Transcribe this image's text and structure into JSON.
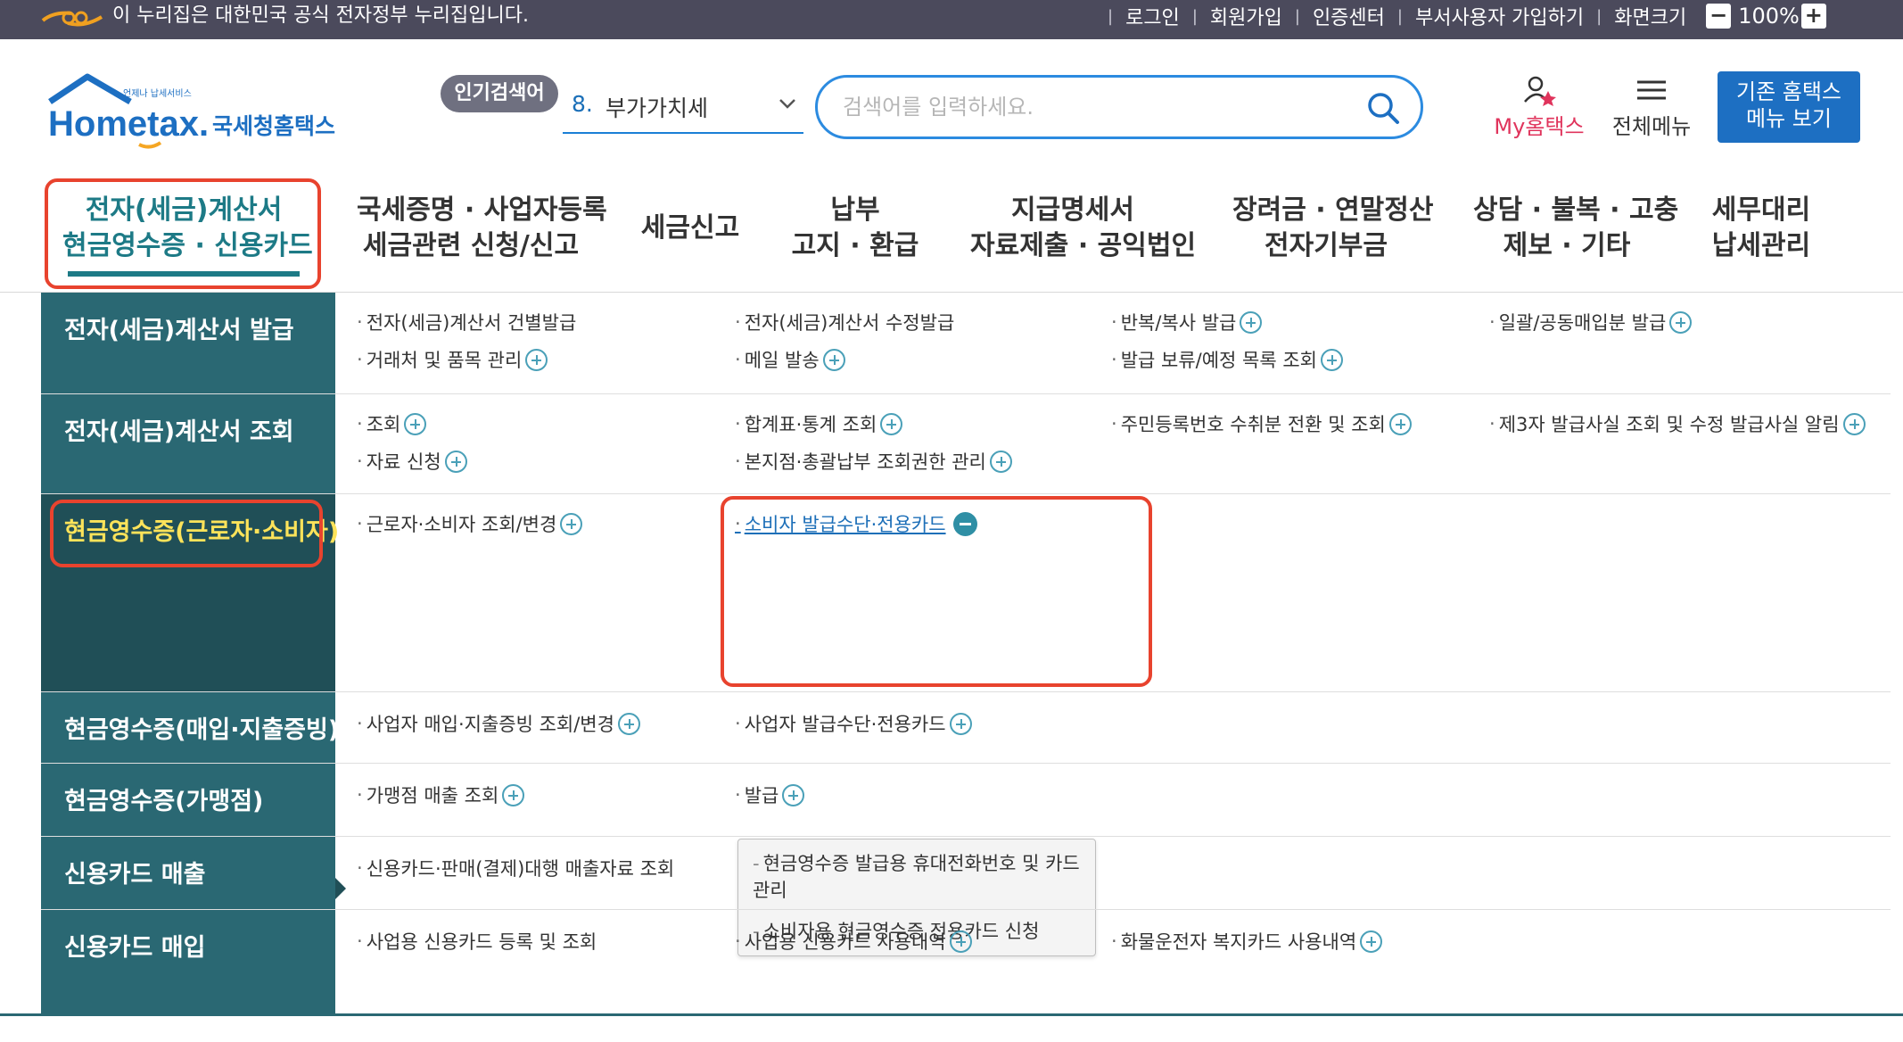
{
  "topbar": {
    "notice": "이 누리집은 대한민국 공식 전자정부 누리집입니다.",
    "links": [
      "로그인",
      "회원가입",
      "인증센터",
      "부서사용자 가입하기",
      "화면크기"
    ],
    "zoom_minus": "−",
    "zoom_value": "100%",
    "zoom_plus": "+"
  },
  "header": {
    "logo_small": "언제나 납세서비스",
    "logo_main": "Hometax.",
    "logo_sub": "국세청홈택스",
    "hot_badge": "인기검색어",
    "hot_number": "8.",
    "hot_word": "부가가치세",
    "search_placeholder": "검색어를 입력하세요.",
    "my_hometax": "My홈택스",
    "all_menu": "전체메뉴",
    "old_menu_line1": "기존 홈택스",
    "old_menu_line2": "메뉴 보기"
  },
  "nav": {
    "items": [
      {
        "line1": "전자(세금)계산서",
        "line2": "현금영수증 · 신용카드"
      },
      {
        "line1": "국세증명 · 사업자등록",
        "line2": "세금관련 신청/신고"
      },
      {
        "line1": "세금신고",
        "line2": ""
      },
      {
        "line1": "납부",
        "line2": "고지 · 환급"
      },
      {
        "line1": "지급명세서",
        "line2": "자료제출 · 공익법인"
      },
      {
        "line1": "장려금 · 연말정산",
        "line2": "전자기부금"
      },
      {
        "line1": "상담 · 불복 · 고충",
        "line2": "제보 · 기타"
      },
      {
        "line1": "세무대리",
        "line2": "납세관리"
      }
    ]
  },
  "mega": {
    "categories": [
      "전자(세금)계산서 발급",
      "전자(세금)계산서 조회",
      "현금영수증(근로자·소비자)",
      "현금영수증(매입·지출증빙)",
      "현금영수증(가맹점)",
      "신용카드 매출",
      "신용카드 매입"
    ],
    "row0": [
      "전자(세금)계산서 건별발급",
      "전자(세금)계산서 수정발급",
      "반복/복사 발급",
      "일괄/공동매입분 발급",
      "거래처 및 품목 관리",
      "메일 발송",
      "발급 보류/예정 목록 조회"
    ],
    "row1": [
      "조회",
      "합계표·통계 조회",
      "주민등록번호 수취분 전환 및 조회",
      "제3자 발급사실 조회 및 수정 발급사실 알림",
      "자료 신청",
      "본지점·총괄납부 조회권한 관리"
    ],
    "row2": [
      "근로자·소비자 조회/변경",
      "소비자 발급수단·전용카드"
    ],
    "row2_sub": [
      "현금영수증 발급용 휴대전화번호 및 카드관리",
      "소비자용 현금영수증 전용카드 신청"
    ],
    "row3": [
      "사업자 매입·지출증빙 조회/변경",
      "사업자 발급수단·전용카드"
    ],
    "row4": [
      "가맹점 매출 조회",
      "발급"
    ],
    "row5": [
      "신용카드·판매(결제)대행 매출자료 조회"
    ],
    "row6": [
      "사업용 신용카드 등록 및 조회",
      "사업용 신용카드 사용내역",
      "화물운전자 복지카드 사용내역"
    ]
  },
  "colors": {
    "topbar": "#4b4a5c",
    "accent_teal": "#2a6873",
    "highlight_red": "#e8432e",
    "link_blue": "#1d6fb8"
  }
}
